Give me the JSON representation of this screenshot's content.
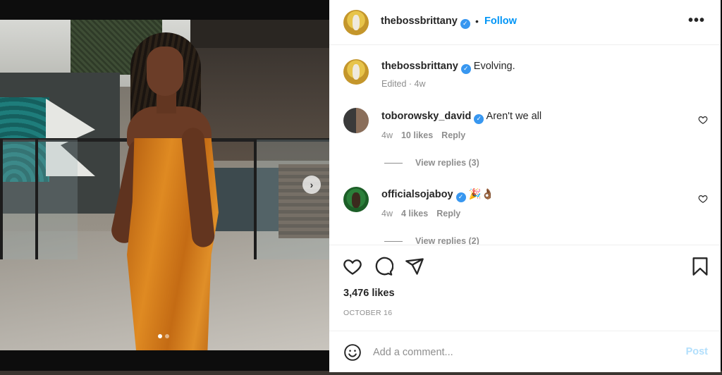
{
  "post": {
    "author": "thebossbrittany",
    "follow_label": "Follow",
    "separator": "•",
    "more_label": "•••",
    "caption": {
      "username": "thebossbrittany",
      "text": "Evolving.",
      "meta": "Edited · 4w"
    },
    "comments": [
      {
        "username": "toborowsky_david",
        "text": "Aren't we all",
        "age": "4w",
        "likes": "10 likes",
        "reply_label": "Reply",
        "view_replies": "View replies (3)"
      },
      {
        "username": "officialsojaboy",
        "text": "🎉👌🏾",
        "age": "4w",
        "likes": "4 likes",
        "reply_label": "Reply",
        "view_replies": "View replies (2)"
      }
    ],
    "likes_count": "3,476 likes",
    "date": "OCTOBER 16",
    "add_comment_placeholder": "Add a comment...",
    "post_label": "Post",
    "carousel": {
      "slides": 2,
      "current": 1,
      "next_icon": "›"
    }
  },
  "icons": {
    "verified": "verified-badge-icon",
    "heart": "heart-icon",
    "comment": "comment-icon",
    "share": "share-icon",
    "bookmark": "bookmark-icon",
    "emoji": "emoji-icon",
    "next": "chevron-right-icon"
  },
  "colors": {
    "accent": "#0095f6",
    "verified": "#3897f0",
    "post_disabled": "#b2dffc",
    "muted": "#8e8e8e"
  }
}
